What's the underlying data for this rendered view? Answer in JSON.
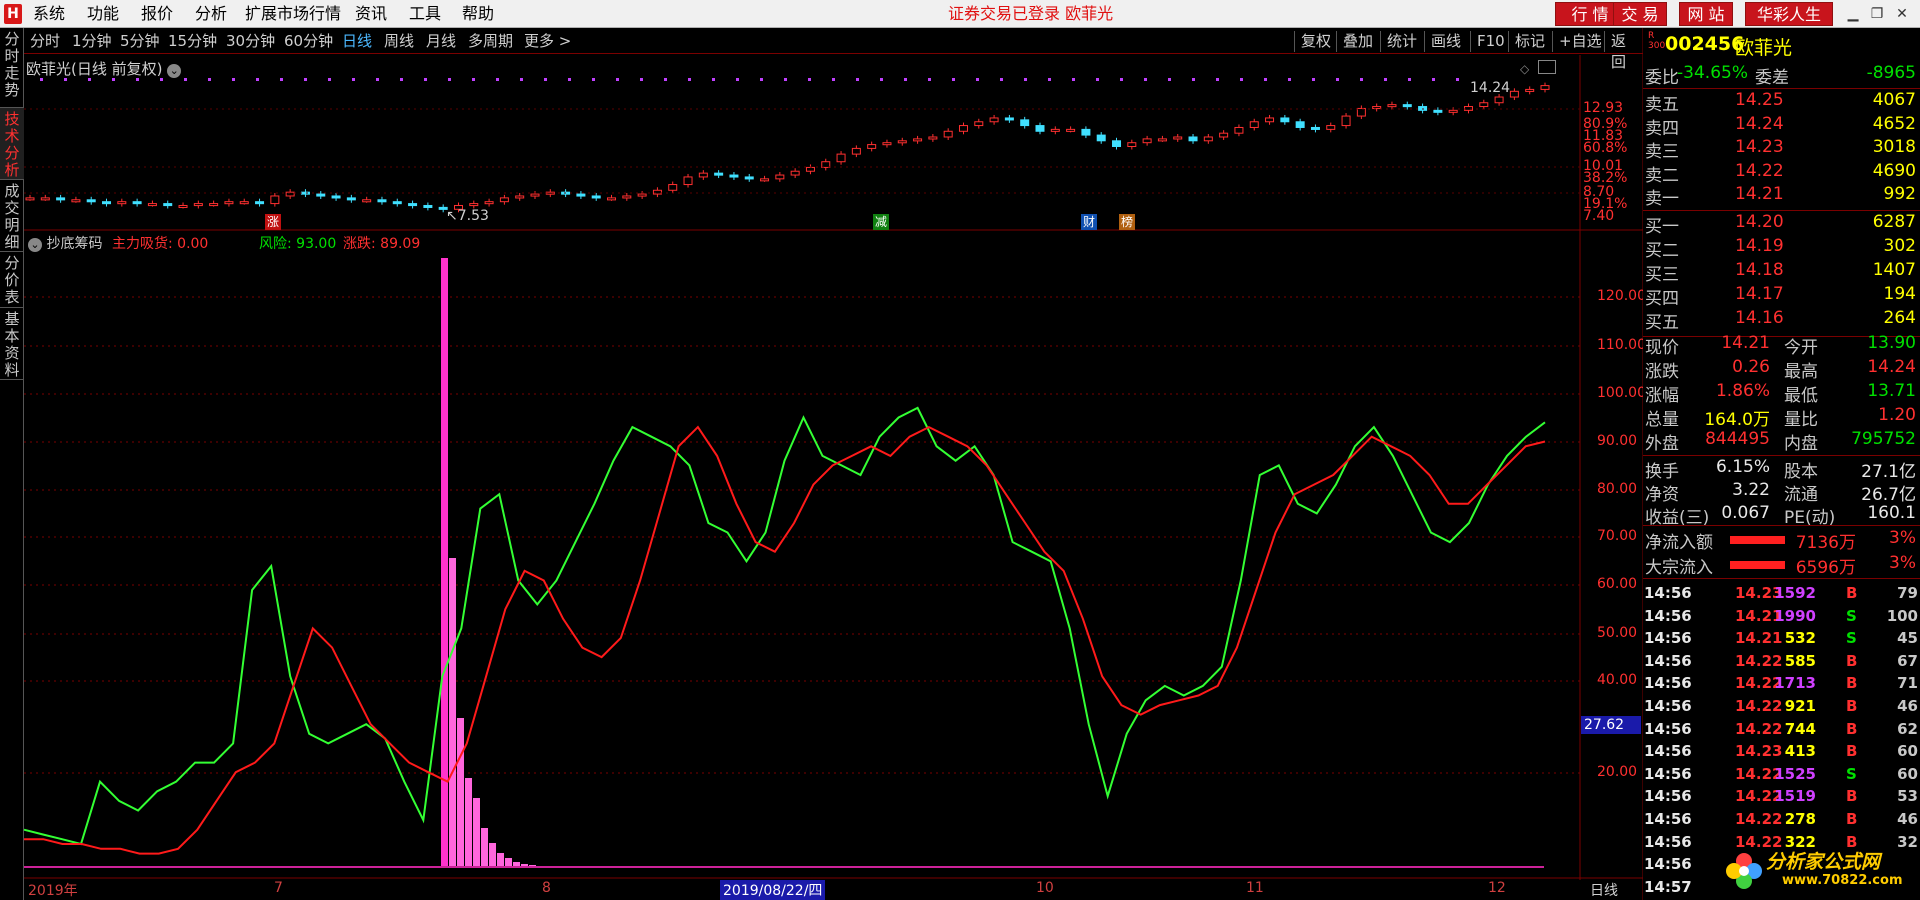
{
  "menubar": {
    "logo": "H",
    "items": [
      "系统",
      "功能",
      "报价",
      "分析",
      "扩展市场行情",
      "资讯",
      "工具",
      "帮助"
    ],
    "status": "证券交易已登录",
    "status_name": "欧菲光",
    "right_buttons": [
      "行 情",
      "交 易",
      "网 站",
      "华彩人生"
    ],
    "window_buttons": [
      "▁",
      "❐",
      "✕"
    ]
  },
  "left_tabs": [
    "分时走势",
    "技术分析",
    "成交明细",
    "分价表",
    "基本资料"
  ],
  "period_toolbar": {
    "items": [
      "分时",
      "1分钟",
      "5分钟",
      "15分钟",
      "30分钟",
      "60分钟",
      "日线",
      "周线",
      "月线",
      "多周期",
      "更多 >"
    ],
    "active": "日线",
    "right_items": [
      "复权",
      "叠加",
      "统计",
      "画线",
      "F10",
      "标记",
      "+自选",
      "返回"
    ]
  },
  "kline": {
    "title": "欧菲光(日线 前复权)",
    "price_axis": [
      "12.93",
      "80.9%",
      "11.83",
      "60.8%",
      "10.01",
      "38.2%",
      "8.70",
      "19.1%",
      "7.40"
    ],
    "high_label": "14.24",
    "low_label": "7.53",
    "event_markers": [
      {
        "text": "涨",
        "color": "#c01010"
      },
      {
        "text": "减",
        "color": "#108010"
      },
      {
        "text": "财",
        "color": "#1050b0"
      },
      {
        "text": "榜",
        "color": "#b06010"
      }
    ]
  },
  "indicator": {
    "name": "抄底筹码",
    "label1": "主力吸货: 0.00",
    "label2": "风险: 93.00",
    "label3": "涨跌: 89.09",
    "y_axis": [
      "120.00",
      "110.00",
      "100.00",
      "90.00",
      "80.00",
      "70.00",
      "60.00",
      "50.00",
      "40.00",
      "20.00"
    ],
    "cursor_value": "27.62"
  },
  "date_bar": {
    "labels": [
      "2019年",
      "7",
      "8",
      "10",
      "11",
      "12"
    ],
    "cursor_date": "2019/08/22/四",
    "period": "日线"
  },
  "quote": {
    "code": "002456",
    "name": "欧菲光",
    "code_prefix": "R\n300",
    "weibi_label": "委比",
    "weibi_value": "-34.65%",
    "weicha_label": "委差",
    "weicha_value": "-8965",
    "asks": [
      {
        "label": "卖五",
        "price": "14.25",
        "vol": "4067"
      },
      {
        "label": "卖四",
        "price": "14.24",
        "vol": "4652"
      },
      {
        "label": "卖三",
        "price": "14.23",
        "vol": "3018"
      },
      {
        "label": "卖二",
        "price": "14.22",
        "vol": "4690"
      },
      {
        "label": "卖一",
        "price": "14.21",
        "vol": "992"
      }
    ],
    "bids": [
      {
        "label": "买一",
        "price": "14.20",
        "vol": "6287"
      },
      {
        "label": "买二",
        "price": "14.19",
        "vol": "302"
      },
      {
        "label": "买三",
        "price": "14.18",
        "vol": "1407"
      },
      {
        "label": "买四",
        "price": "14.17",
        "vol": "194"
      },
      {
        "label": "买五",
        "price": "14.16",
        "vol": "264"
      }
    ],
    "stats": [
      {
        "l1": "现价",
        "v1": "14.21",
        "c1": "#ff3030",
        "l2": "今开",
        "v2": "13.90",
        "c2": "#00e000"
      },
      {
        "l1": "涨跌",
        "v1": "0.26",
        "c1": "#ff3030",
        "l2": "最高",
        "v2": "14.24",
        "c2": "#ff3030"
      },
      {
        "l1": "涨幅",
        "v1": "1.86%",
        "c1": "#ff3030",
        "l2": "最低",
        "v2": "13.71",
        "c2": "#00e000"
      },
      {
        "l1": "总量",
        "v1": "164.0万",
        "c1": "#ffff00",
        "l2": "量比",
        "v2": "1.20",
        "c2": "#ff3030"
      },
      {
        "l1": "外盘",
        "v1": "844495",
        "c1": "#ff3030",
        "l2": "内盘",
        "v2": "795752",
        "c2": "#00e000"
      }
    ],
    "stats2": [
      {
        "l1": "换手",
        "v1": "6.15%",
        "l2": "股本",
        "v2": "27.1亿"
      },
      {
        "l1": "净资",
        "v1": "3.22",
        "l2": "流通",
        "v2": "26.7亿"
      },
      {
        "l1": "收益(三)",
        "v1": "0.067",
        "l2": "PE(动)",
        "v2": "160.1"
      }
    ],
    "flows": [
      {
        "label": "净流入额",
        "value": "7136万",
        "pct": "3%"
      },
      {
        "label": "大宗流入",
        "value": "6596万",
        "pct": "3%"
      }
    ],
    "ticks": [
      {
        "time": "14:56",
        "price": "14.23",
        "vol": "1592",
        "bs": "B",
        "n": "79"
      },
      {
        "time": "14:56",
        "price": "14.21",
        "vol": "1990",
        "bs": "S",
        "n": "100"
      },
      {
        "time": "14:56",
        "price": "14.21",
        "vol": "532",
        "bs": "S",
        "n": "45"
      },
      {
        "time": "14:56",
        "price": "14.22",
        "vol": "585",
        "bs": "B",
        "n": "67"
      },
      {
        "time": "14:56",
        "price": "14.22",
        "vol": "1713",
        "bs": "B",
        "n": "71"
      },
      {
        "time": "14:56",
        "price": "14.22",
        "vol": "921",
        "bs": "B",
        "n": "46"
      },
      {
        "time": "14:56",
        "price": "14.22",
        "vol": "744",
        "bs": "B",
        "n": "62"
      },
      {
        "time": "14:56",
        "price": "14.23",
        "vol": "413",
        "bs": "B",
        "n": "60"
      },
      {
        "time": "14:56",
        "price": "14.22",
        "vol": "1525",
        "bs": "S",
        "n": "60"
      },
      {
        "time": "14:56",
        "price": "14.22",
        "vol": "1519",
        "bs": "B",
        "n": "53"
      },
      {
        "time": "14:56",
        "price": "14.22",
        "vol": "278",
        "bs": "B",
        "n": "46"
      },
      {
        "time": "14:56",
        "price": "14.22",
        "vol": "322",
        "bs": "B",
        "n": "32"
      },
      {
        "time": "14:56",
        "price": "",
        "vol": "",
        "bs": "",
        "n": ""
      },
      {
        "time": "14:57",
        "price": "",
        "vol": "",
        "bs": "",
        "n": ""
      }
    ],
    "watermark": "分析家公式网",
    "watermark_url": "www.70822.com"
  },
  "colors": {
    "up": "#ff3030",
    "down": "#00e000",
    "risk_line": "#33ff33",
    "trend_line": "#ff1a1a",
    "volume_bar": "#ff33cc",
    "cursor": "#1a1aaa",
    "border": "#7a0000"
  },
  "chart_data": {
    "type": "line",
    "title": "抄底筹码",
    "series": [
      {
        "name": "风险",
        "values": [
          8,
          7,
          6,
          5,
          18,
          14,
          12,
          16,
          18,
          22,
          22,
          26,
          58,
          63,
          40,
          28,
          26,
          28,
          30,
          27,
          18,
          10,
          40,
          50,
          75,
          78,
          60,
          55,
          60,
          68,
          76,
          85,
          92,
          90,
          88,
          84,
          72,
          70,
          64,
          70,
          85,
          94,
          86,
          84,
          82,
          90,
          94,
          96,
          88,
          85,
          88,
          82,
          68,
          66,
          64,
          50,
          30,
          15,
          28,
          35,
          38,
          36,
          38,
          42,
          60,
          82,
          84,
          76,
          74,
          80,
          88,
          92,
          86,
          78,
          70,
          68,
          72,
          80,
          86,
          90,
          93
        ]
      },
      {
        "name": "涨跌",
        "values": [
          6,
          6,
          5,
          5,
          4,
          4,
          3,
          3,
          4,
          8,
          14,
          20,
          22,
          26,
          38,
          50,
          46,
          38,
          30,
          26,
          22,
          20,
          18,
          26,
          40,
          54,
          62,
          60,
          52,
          46,
          44,
          48,
          60,
          74,
          88,
          92,
          86,
          76,
          68,
          66,
          72,
          80,
          84,
          86,
          88,
          86,
          90,
          92,
          90,
          88,
          84,
          78,
          72,
          66,
          62,
          52,
          40,
          34,
          32,
          34,
          35,
          36,
          38,
          46,
          58,
          70,
          78,
          80,
          82,
          86,
          90,
          88,
          86,
          82,
          76,
          76,
          80,
          84,
          88,
          89
        ]
      }
    ],
    "ylim": [
      0,
      130
    ]
  }
}
